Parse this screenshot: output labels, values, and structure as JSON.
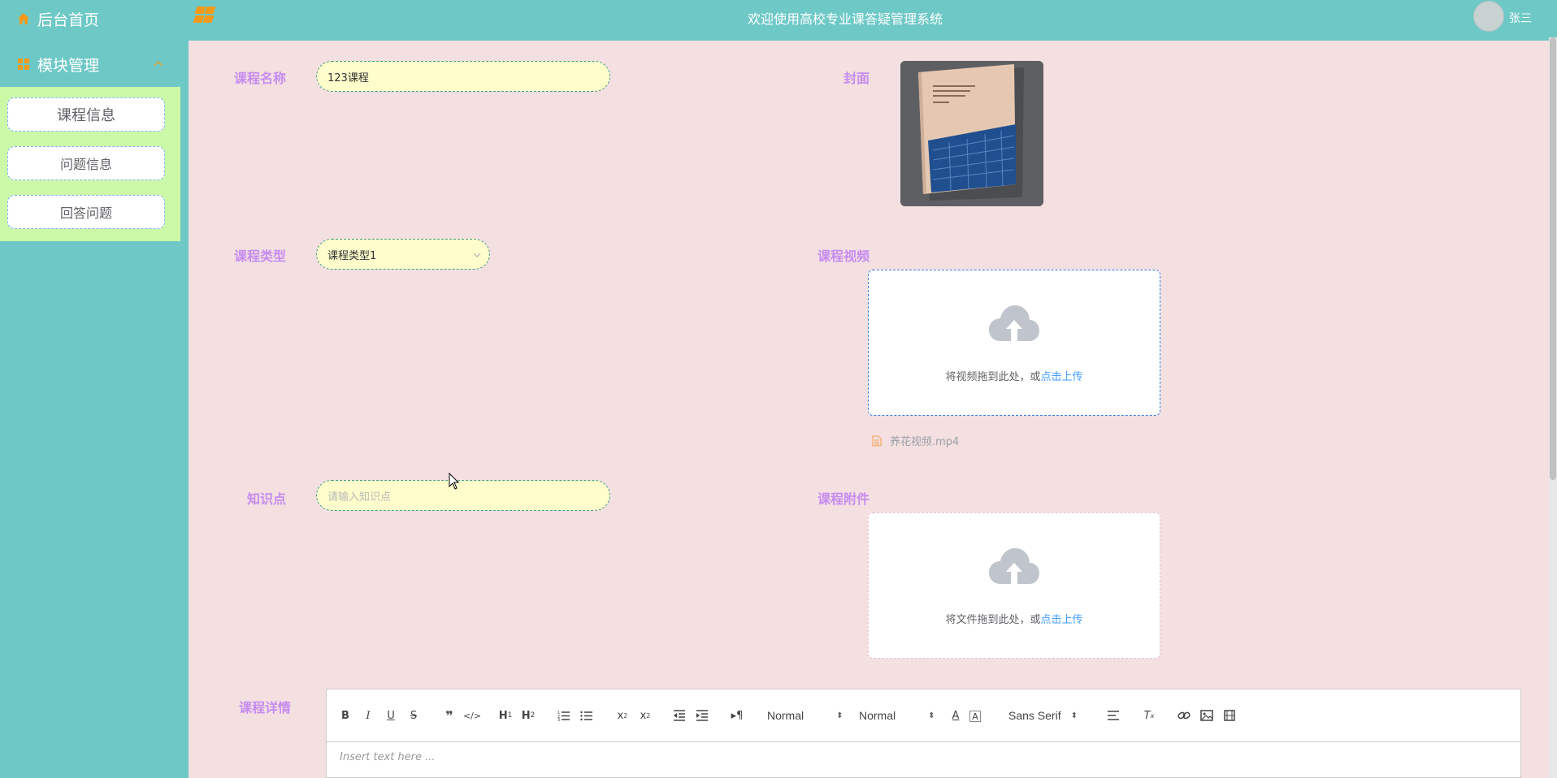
{
  "header": {
    "title": "欢迎使用高校专业课答疑管理系统",
    "username": "张三"
  },
  "sidebar": {
    "home_label": "后台首页",
    "module_label": "模块管理",
    "items": [
      {
        "label": "课程信息"
      },
      {
        "label": "问题信息"
      },
      {
        "label": "回答问题"
      }
    ]
  },
  "form": {
    "course_name": {
      "label": "课程名称",
      "value": "123课程"
    },
    "cover": {
      "label": "封面"
    },
    "course_type": {
      "label": "课程类型",
      "value": "课程类型1"
    },
    "course_video": {
      "label": "课程视频",
      "upload_text": "将视频拖到此处，或",
      "upload_link": "点击上传",
      "file_name": "养花视频.mp4"
    },
    "knowledge_point": {
      "label": "知识点",
      "placeholder": "请输入知识点"
    },
    "course_attachment": {
      "label": "课程附件",
      "upload_text": "将文件拖到此处，或",
      "upload_link": "点击上传"
    },
    "course_detail": {
      "label": "课程详情"
    }
  },
  "editor": {
    "header_picker": "Normal",
    "size_picker": "Normal",
    "font_picker": "Sans Serif",
    "placeholder": "Insert text here ..."
  },
  "colors": {
    "sidebar": "#6ec9c6",
    "content": "#f4dfe1",
    "label": "#c58cf0",
    "input_bg": "#fefdcb",
    "submenu_bg": "#ccf9a7",
    "link": "#409eff"
  }
}
